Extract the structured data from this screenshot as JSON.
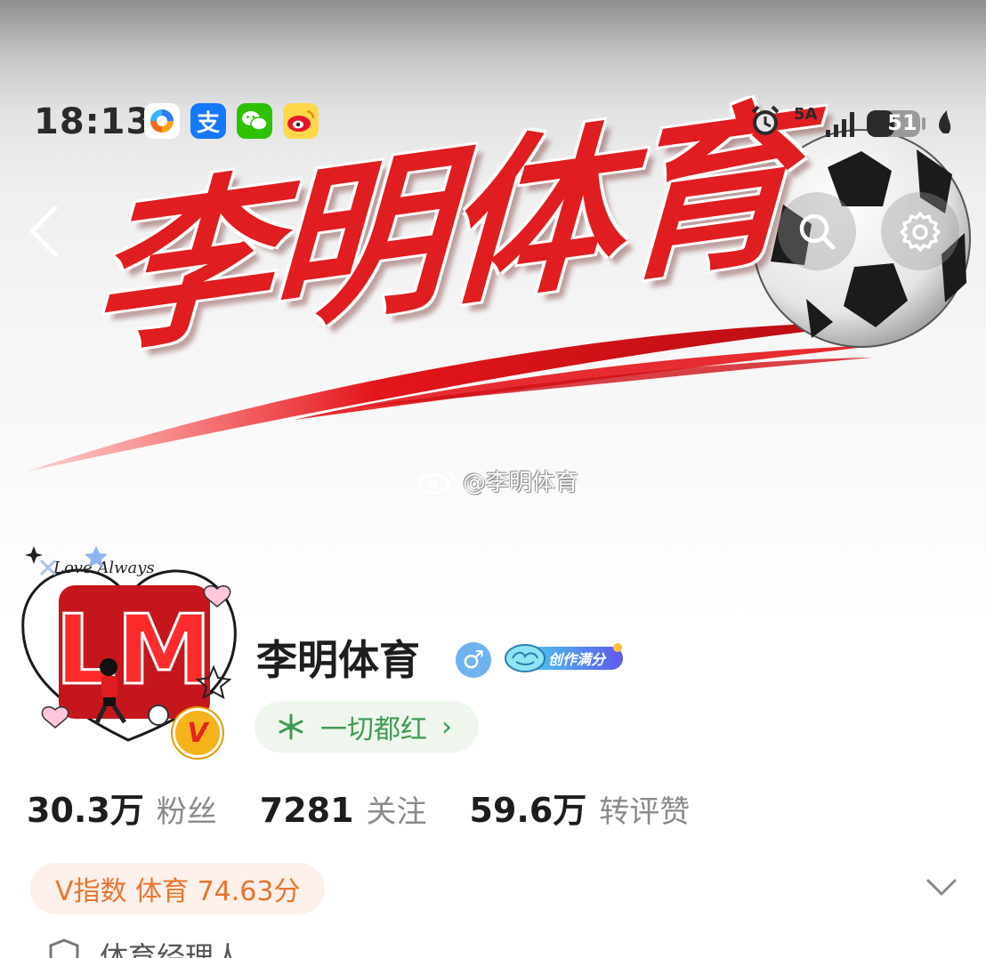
{
  "status_bar": {
    "time": "18:13",
    "app_icons": [
      "browser-app-icon",
      "alipay-icon",
      "wechat-icon",
      "weibo-icon"
    ],
    "alipay_glyph": "支",
    "network_label": "5A",
    "battery": "51"
  },
  "banner": {
    "title": "李明体育",
    "watermark": "@李明体育"
  },
  "profile": {
    "avatar_text": "LM",
    "avatar_caption": "Love Always",
    "verified_mark": "V",
    "name": "李明体育",
    "gender_symbol": "♂",
    "creator_badge": "创作满分",
    "tag": "一切都红",
    "tag_chevron": "›"
  },
  "stats": [
    {
      "value": "30.3万",
      "label": "粉丝"
    },
    {
      "value": "7281",
      "label": "关注"
    },
    {
      "value": "59.6万",
      "label": "转评赞"
    }
  ],
  "v_index": "V指数 体育 74.63分",
  "certification": "体育经理人",
  "colors": {
    "brand_red": "#e01d20",
    "tag_green": "#3f9a52",
    "vindex_orange": "#e8742f",
    "gender_blue": "#6fb2ee"
  }
}
